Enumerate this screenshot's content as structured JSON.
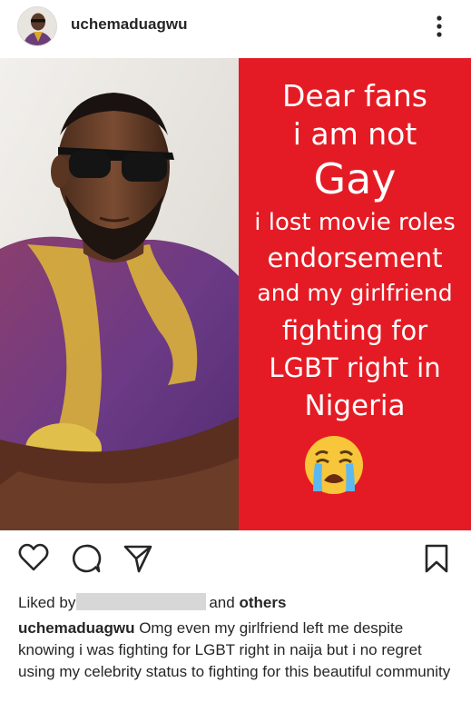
{
  "header": {
    "username": "uchemaduagwu",
    "avatar_icon": "profile-avatar",
    "more_icon": "more-vertical-icon"
  },
  "poster": {
    "background_color": "#e41b24",
    "lines": [
      "Dear fans",
      "i am not",
      "Gay",
      "i lost movie roles",
      "endorsement",
      "and my girlfriend",
      "fighting for",
      "LGBT right in",
      "Nigeria"
    ],
    "emoji": "loudly-crying-face"
  },
  "actions": {
    "like_icon": "heart-icon",
    "comment_icon": "comment-icon",
    "share_icon": "paper-plane-icon",
    "save_icon": "bookmark-icon"
  },
  "likes": {
    "prefix": "Liked by",
    "suffix": "and",
    "others": "others"
  },
  "caption": {
    "username": "uchemaduagwu",
    "text": "Omg even my girlfriend left me despite knowing i was fighting for LGBT right in naija but i no regret using my celebrity status to fighting for this beautiful community"
  }
}
